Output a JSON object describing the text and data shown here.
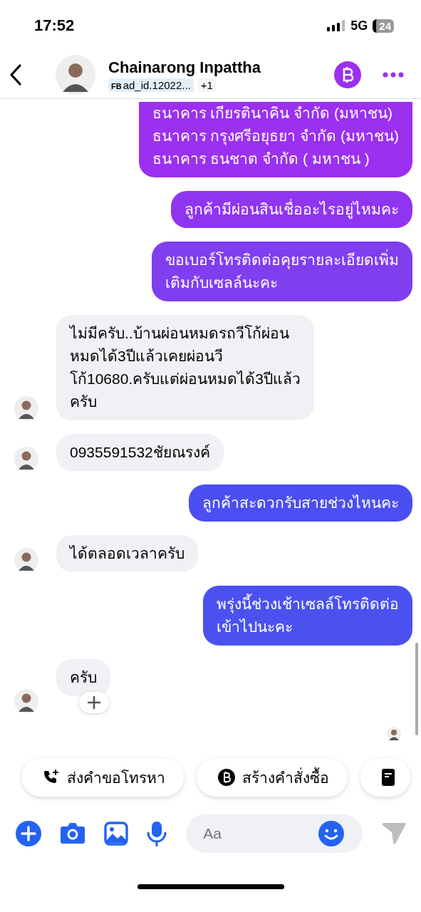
{
  "status_bar": {
    "time": "17:52",
    "network": "5G",
    "battery": "24"
  },
  "header": {
    "name": "Chainarong Inpattha",
    "source_tag": "FB",
    "ad_tag": "ad_id.12022...",
    "extra_count": "+1"
  },
  "messages": [
    {
      "kind": "outgoing",
      "lines": [
        "ธนาคาร เกียรตินาคิน จำกัด (มหาชน)",
        "ธนาคาร กรุงศรีอยุธยา จำกัด (มหาชน)",
        "ธนาคาร ธนชาต จำกัด ( มหาชน )"
      ]
    },
    {
      "kind": "outgoing",
      "lines": [
        "ลูกค้ามีผ่อนสินเชื่ออะไรอยู่ไหมคะ"
      ]
    },
    {
      "kind": "outgoing",
      "lines": [
        "ขอเบอร์โทรติดต่อคุยรายละเอียดเพิ่ม",
        "เติมกับเซลล์นะคะ"
      ]
    },
    {
      "kind": "incoming",
      "lines": [
        "ไม่มีครับ..บ้านผ่อนหมดรถวีโก้ผ่อน",
        "หมดได้3ปีแล้วเคยผ่อนวี",
        "โก้10680.ครับแต่ผ่อนหมดได้3ปีแล้ว",
        "ครับ"
      ]
    },
    {
      "kind": "incoming",
      "lines": [
        "0935591532ชัยณรงค์"
      ]
    },
    {
      "kind": "outgoing",
      "lines": [
        "ลูกค้าสะดวกรับสายช่วงไหนคะ"
      ]
    },
    {
      "kind": "incoming",
      "lines": [
        "ได้ตลอดเวลาครับ"
      ]
    },
    {
      "kind": "outgoing",
      "lines": [
        "พรุ่งนี้ช่วงเช้าเซลล์โทรติดต่อ",
        "เข้าไปนะคะ"
      ]
    },
    {
      "kind": "incoming",
      "lines": [
        "ครับ"
      ],
      "reaction_button": true
    }
  ],
  "quick_replies": [
    {
      "kind": "call",
      "label": "ส่งคำขอโทรหา"
    },
    {
      "kind": "order",
      "label": "สร้างคำสั่งซื้อ"
    },
    {
      "kind": "note"
    }
  ],
  "composer": {
    "placeholder": "Aa"
  }
}
